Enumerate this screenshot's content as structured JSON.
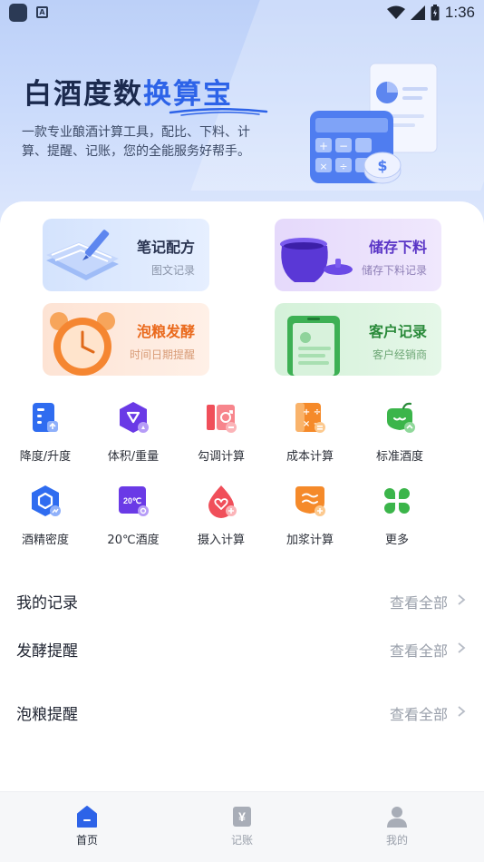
{
  "status_bar": {
    "time": "1:36",
    "app_icon_letter": "A"
  },
  "hero": {
    "title_part1": "白酒度数",
    "title_part2": "换算宝",
    "subtitle": "一款专业酿酒计算工具，配比、下料、计算、提醒、记账，您的全能服务好帮手。",
    "accent_color": "#2d63e8"
  },
  "cards": [
    {
      "title": "笔记配方",
      "subtitle": "图文记录",
      "icon": "notebook-pen-icon"
    },
    {
      "title": "储存下料",
      "subtitle": "储存下料记录",
      "icon": "storage-jar-icon"
    },
    {
      "title": "泡粮发酵",
      "subtitle": "时间日期提醒",
      "icon": "alarm-clock-icon"
    },
    {
      "title": "客户记录",
      "subtitle": "客户经销商",
      "icon": "phone-contacts-icon"
    }
  ],
  "tools": [
    {
      "label": "降度/升度",
      "icon": "degree-adjust-icon"
    },
    {
      "label": "体积/重量",
      "icon": "volume-weight-icon"
    },
    {
      "label": "勾调计算",
      "icon": "blend-calc-icon"
    },
    {
      "label": "成本计算",
      "icon": "cost-calc-icon"
    },
    {
      "label": "标准酒度",
      "icon": "standard-proof-icon"
    },
    {
      "label": "酒精密度",
      "icon": "alcohol-density-icon"
    },
    {
      "label": "20℃酒度",
      "icon": "temp-proof-icon",
      "icon_text": "20℃"
    },
    {
      "label": "摄入计算",
      "icon": "intake-calc-icon"
    },
    {
      "label": "加浆计算",
      "icon": "add-water-calc-icon"
    },
    {
      "label": "更多",
      "icon": "more-grid-icon"
    }
  ],
  "sections": [
    {
      "title": "我的记录",
      "link": "查看全部"
    },
    {
      "title": "发酵提醒",
      "link": "查看全部"
    },
    {
      "title": "泡粮提醒",
      "link": "查看全部"
    }
  ],
  "tabbar": {
    "items": [
      {
        "label": "首页",
        "icon": "home-icon",
        "active": true
      },
      {
        "label": "记账",
        "icon": "ledger-icon",
        "icon_text": "¥",
        "active": false
      },
      {
        "label": "我的",
        "icon": "user-icon",
        "active": false
      }
    ],
    "active_color": "#2d63e8",
    "inactive_color": "#9aa0ab"
  }
}
